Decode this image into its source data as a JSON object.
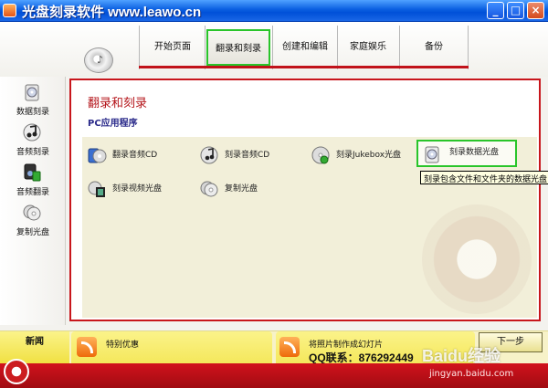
{
  "window": {
    "title": "光盘刻录软件 www.leawo.cn",
    "controls": {
      "minimize": "_",
      "maximize": "□",
      "close": "×"
    }
  },
  "tabs": [
    {
      "label": "开始页面"
    },
    {
      "label": "翻录和刻录",
      "selected": true
    },
    {
      "label": "创建和编辑"
    },
    {
      "label": "家庭娱乐"
    },
    {
      "label": "备份"
    }
  ],
  "sidebar": {
    "items": [
      {
        "label": "数据刻录",
        "icon": "data-disc-icon"
      },
      {
        "label": "音频刻录",
        "icon": "music-note-icon"
      },
      {
        "label": "音频翻录",
        "icon": "audio-rip-icon"
      },
      {
        "label": "复制光盘",
        "icon": "copy-disc-icon"
      }
    ]
  },
  "main": {
    "title": "翻录和刻录",
    "subtitle": "PC应用程序",
    "items": [
      {
        "label": "翻录音频CD",
        "icon": "rip-cd-icon"
      },
      {
        "label": "刻录音频CD",
        "icon": "burn-audio-cd-icon"
      },
      {
        "label": "刻录Jukebox光盘",
        "icon": "jukebox-disc-icon"
      },
      {
        "label": "刻录数据光盘",
        "icon": "data-disc-icon",
        "hovered": true
      },
      {
        "label": "刻录视频光盘",
        "icon": "film-icon"
      },
      {
        "label": "复制光盘",
        "icon": "copy-disc-icon"
      }
    ],
    "tooltip": "刻录包含文件和文件夹的数据光盘"
  },
  "news": {
    "label": "新闻",
    "items": [
      {
        "text": "特别优惠"
      },
      {
        "text": "将照片制作成幻灯片"
      }
    ],
    "qq": "QQ联系：876292449",
    "next": "下一步"
  },
  "watermark": {
    "brand": "Baidu经验",
    "url": "jingyan.baidu.com"
  },
  "colors": {
    "accent_red": "#c8161c",
    "highlight_green": "#29c52a",
    "title_blue": "#0a5fe0",
    "news_yellow": "#f4e75a"
  }
}
